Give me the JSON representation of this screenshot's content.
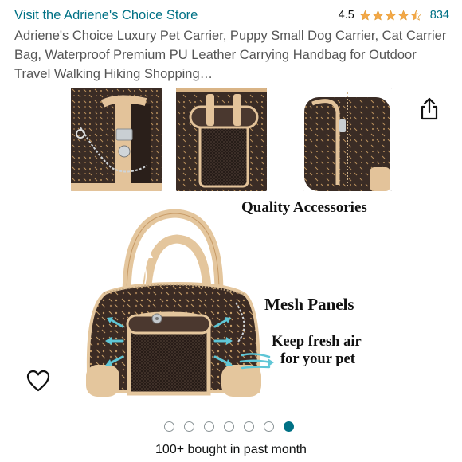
{
  "store": {
    "link_text": "Visit the Adriene's Choice Store",
    "rating_value": "4.5",
    "rating_stars": 4.5,
    "rating_count": "834",
    "star_color": "#F3A847"
  },
  "product": {
    "title": "Adriene's Choice Luxury Pet Carrier, Puppy Small Dog Carrier, Cat Carrier Bag, Waterproof Premium PU Leather Carrying Handbag for Outdoor Travel Walking Hiking Shopping…"
  },
  "image": {
    "caption_quality": "Quality Accessories",
    "caption_mesh": "Mesh Panels",
    "caption_fresh_line1": "Keep fresh air",
    "caption_fresh_line2": "for your pet"
  },
  "carousel": {
    "total_images": 7,
    "active_index": 6,
    "active_color": "#007185"
  },
  "icons": {
    "share": "share-icon",
    "wishlist": "heart-icon"
  },
  "social_proof": {
    "bought_text": "100+ bought in past month"
  }
}
